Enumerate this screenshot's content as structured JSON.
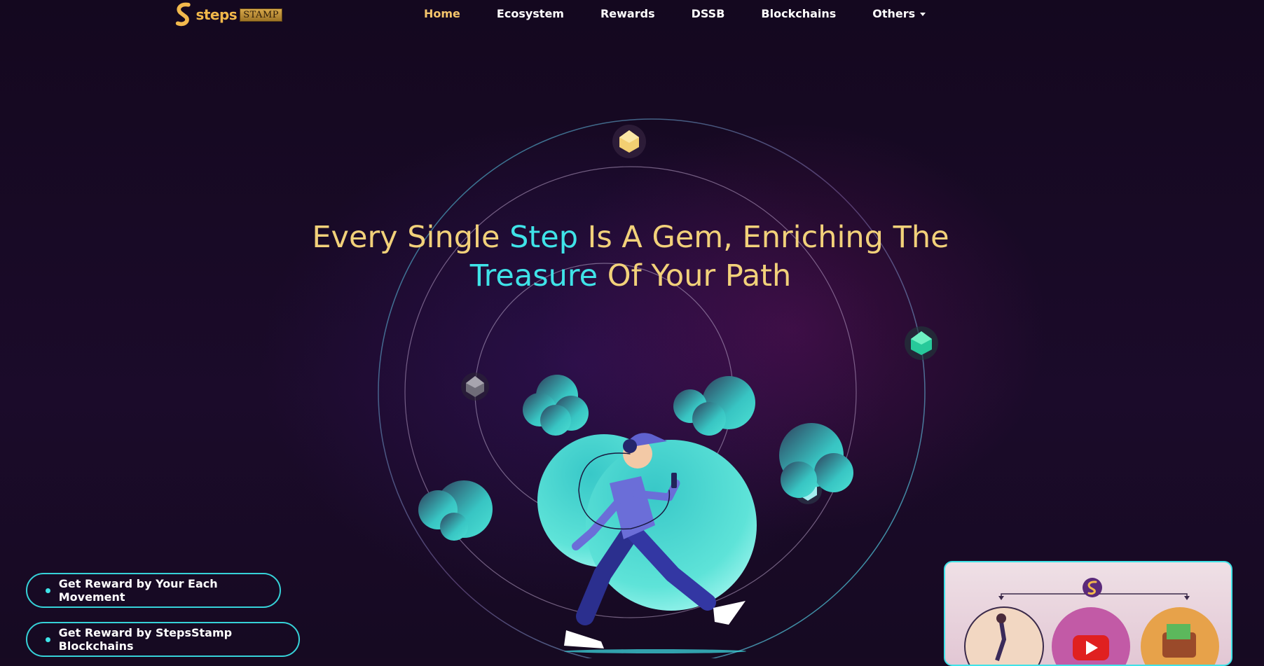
{
  "brand": {
    "name": "steps",
    "stamp": "STAMP"
  },
  "nav": {
    "items": [
      {
        "label": "Home"
      },
      {
        "label": "Ecosystem"
      },
      {
        "label": "Rewards"
      },
      {
        "label": "DSSB"
      },
      {
        "label": "Blockchains"
      },
      {
        "label": "Others"
      }
    ]
  },
  "hero": {
    "line1_a": "Every Single ",
    "line1_b": "Step",
    "line1_c": " Is A Gem, Enriching The",
    "line2_a": "Treasure",
    "line2_b": " Of Your Path"
  },
  "pills": [
    {
      "label": "Get Reward by Your Each Movement"
    },
    {
      "label": "Get Reward by StepsStamp Blockchains"
    }
  ],
  "colors": {
    "accent": "#3fe3e8",
    "gold": "#f2d17a",
    "active_nav": "#f3c46b",
    "background": "#170a22"
  },
  "icons": [
    "steps-logo-icon",
    "gem-gold-icon",
    "gem-green-icon",
    "gem-grey-icon",
    "gem-cyan-icon",
    "youtube-play-icon",
    "wallet-icon"
  ]
}
